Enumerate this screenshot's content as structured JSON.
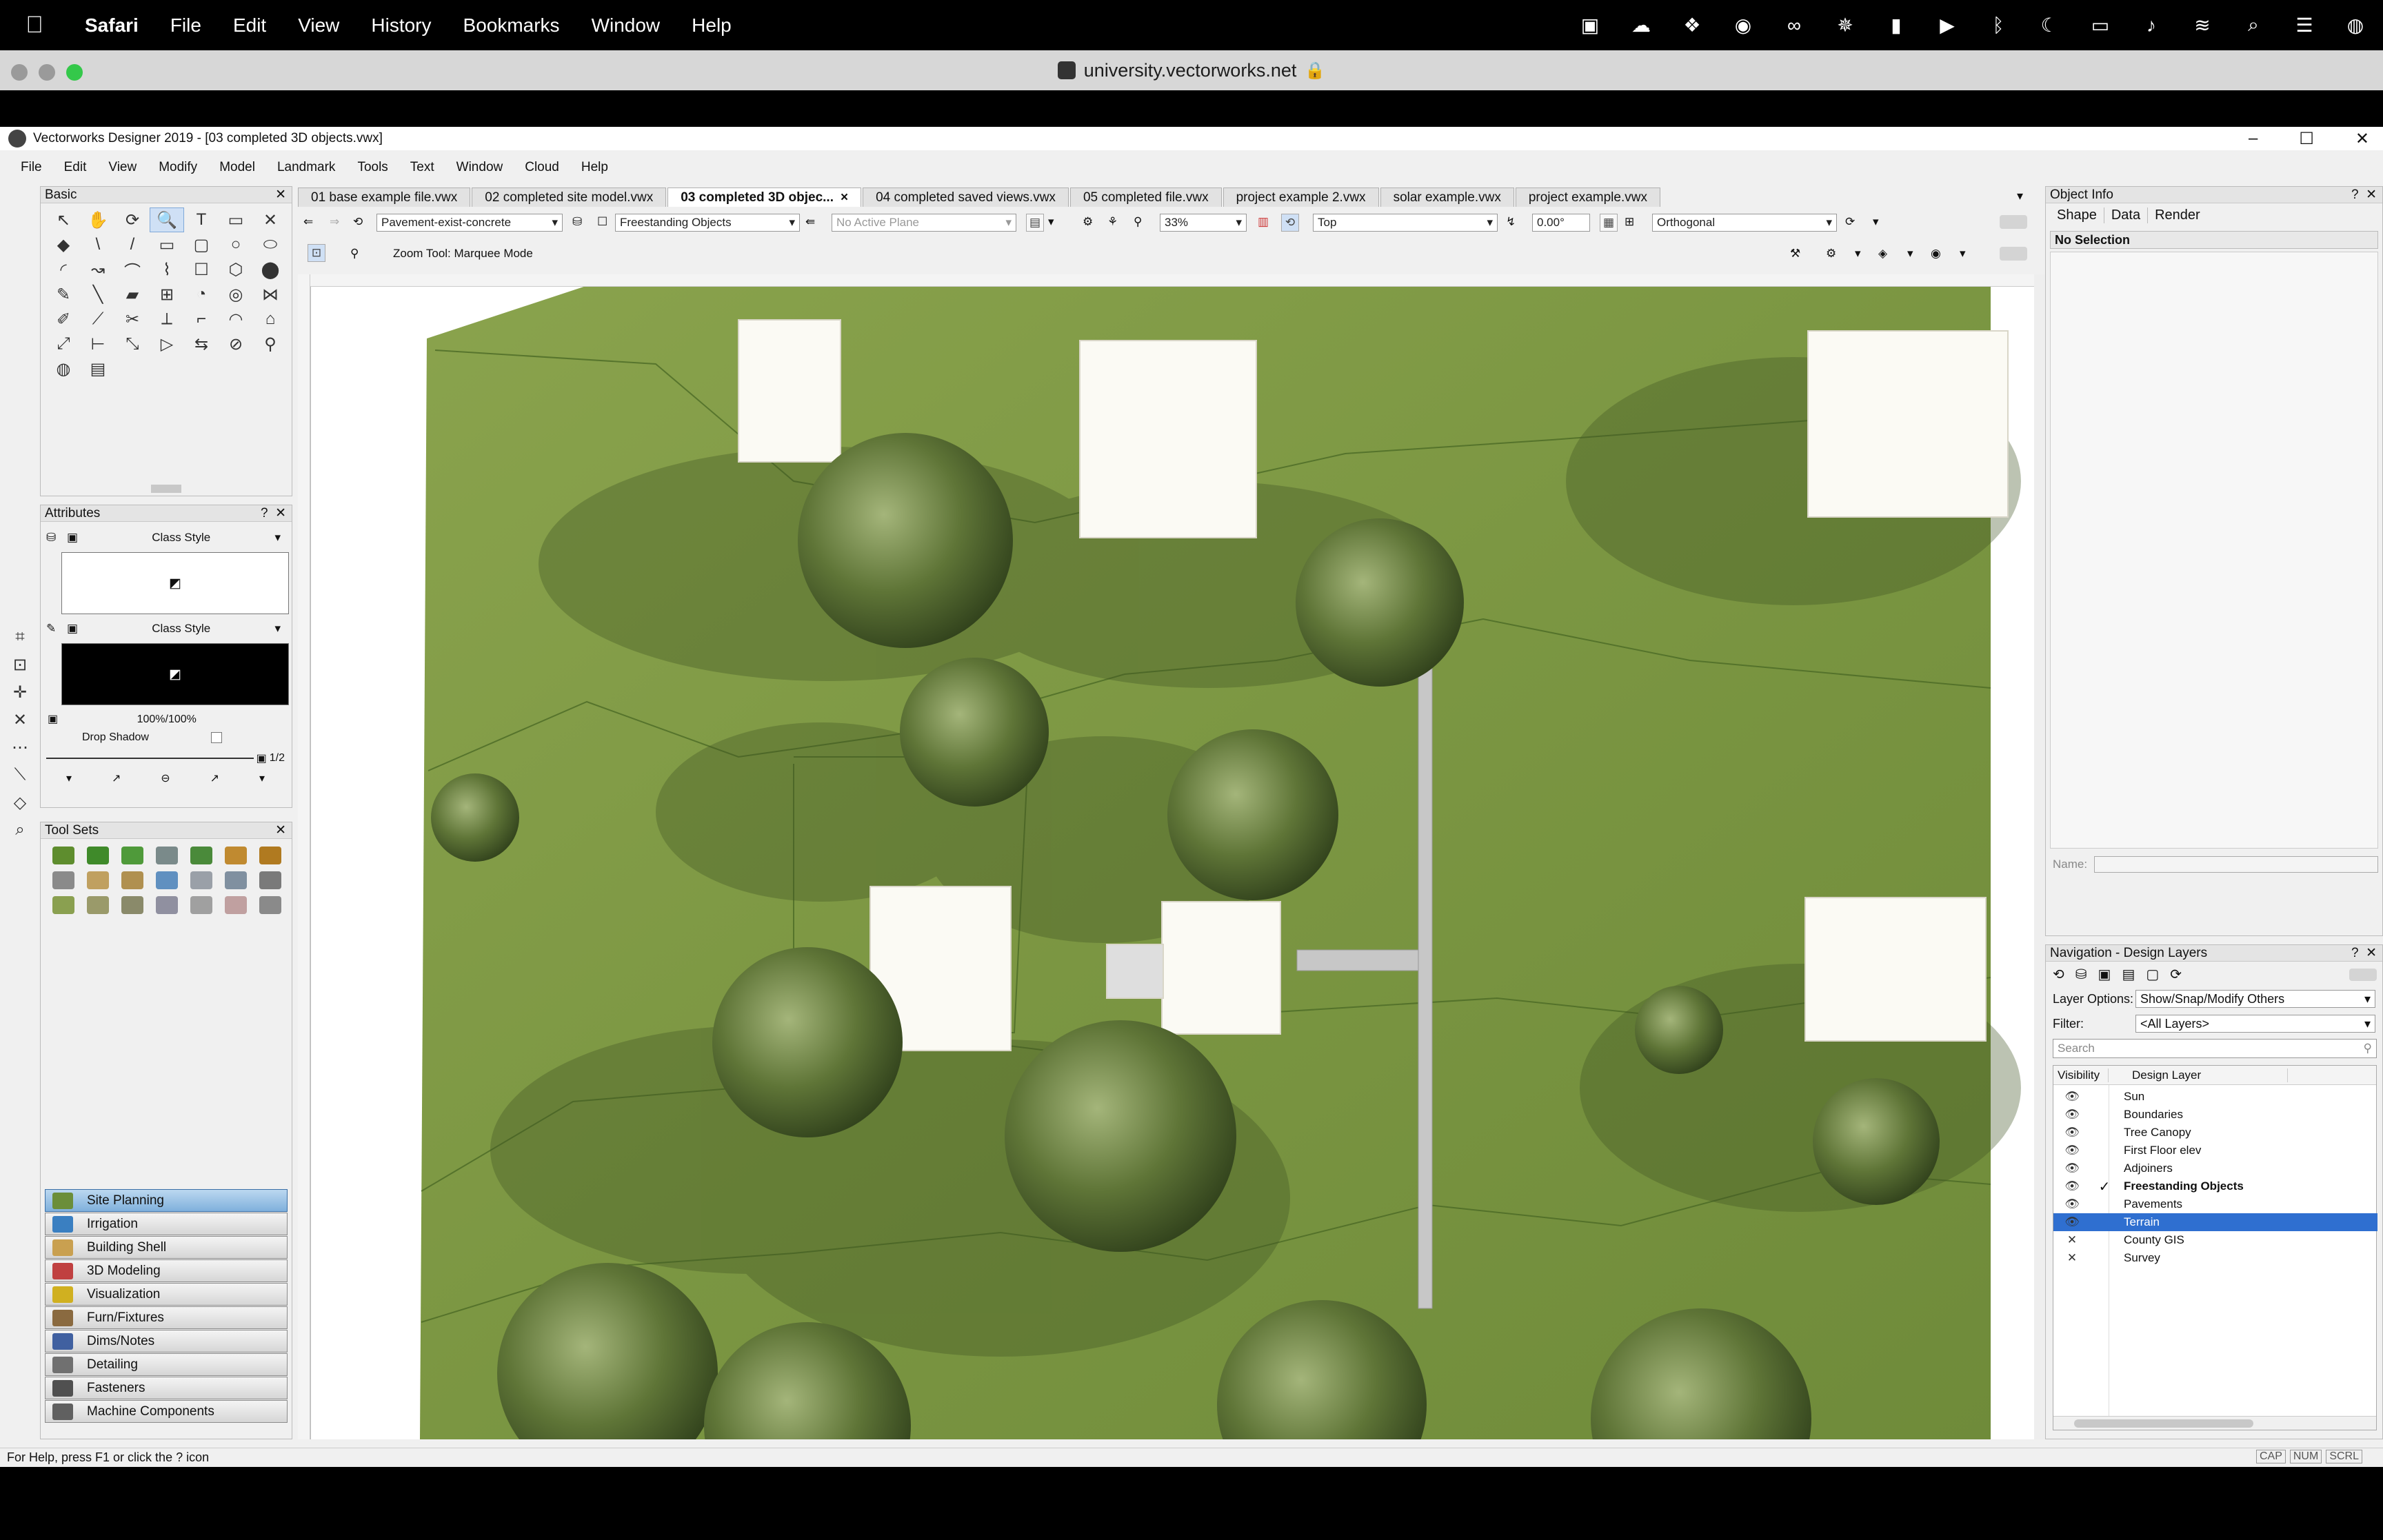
{
  "macos": {
    "app_name": "Safari",
    "menus": [
      "File",
      "Edit",
      "View",
      "History",
      "Bookmarks",
      "Window",
      "Help"
    ]
  },
  "safari": {
    "url": "university.vectorworks.net"
  },
  "vw": {
    "title": "Vectorworks Designer 2019 - [03 completed 3D objects.vwx]",
    "menus": [
      "File",
      "Edit",
      "View",
      "Modify",
      "Model",
      "Landmark",
      "Tools",
      "Text",
      "Window",
      "Cloud",
      "Help"
    ],
    "tabs": [
      {
        "label": "01 base example file.vwx"
      },
      {
        "label": "02 completed site model.vwx"
      },
      {
        "label": "03 completed 3D objec...",
        "active": true
      },
      {
        "label": "04 completed saved views.vwx"
      },
      {
        "label": "05 completed file.vwx"
      },
      {
        "label": "project example 2.vwx"
      },
      {
        "label": "solar example.vwx"
      },
      {
        "label": "project example.vwx"
      }
    ],
    "tab_close": "×",
    "toolbar": {
      "class": "Pavement-exist-concrete",
      "layer": "Freestanding Objects",
      "plane": "No Active Plane",
      "zoom": "33%",
      "view": "Top",
      "angle": "0.00°",
      "render": "Orthogonal"
    },
    "mode_bar": {
      "tool_hint": "Zoom Tool: Marquee Mode"
    },
    "basic_palette": {
      "title": "Basic",
      "tools": [
        "↖",
        "✋",
        "⟳",
        "🔍",
        "T",
        "▭",
        "✕",
        "◆",
        "\\",
        "/",
        "▭",
        "▢",
        "○",
        "⬭",
        "◜",
        "↝",
        "⌒",
        "⌇",
        "☐",
        "⬡",
        "⬤",
        "✎",
        "╲",
        "▰",
        "⊞",
        "◔",
        "◎",
        "⋈",
        "✐",
        "⟋",
        "✂",
        "⟂",
        "⌐",
        "◠",
        "⌂",
        "⤢",
        "⊢",
        "⤡",
        "▷",
        "⇆",
        "⊘",
        "⚲",
        "◍",
        "▤"
      ]
    },
    "attributes": {
      "title": "Attributes",
      "fill_style": "Class Style",
      "pen_style": "Class Style",
      "opacity": "100%/100%",
      "drop_shadow": "Drop Shadow",
      "page": "1/2"
    },
    "tool_sets": {
      "title": "Tool Sets",
      "workspaces": [
        {
          "label": "Site Planning",
          "color": "#6b8e3a",
          "active": true
        },
        {
          "label": "Irrigation",
          "color": "#3a7fc1"
        },
        {
          "label": "Building Shell",
          "color": "#c9a050"
        },
        {
          "label": "3D Modeling",
          "color": "#c04040"
        },
        {
          "label": "Visualization",
          "color": "#d0b020"
        },
        {
          "label": "Furn/Fixtures",
          "color": "#8a6a40"
        },
        {
          "label": "Dims/Notes",
          "color": "#4060a0"
        },
        {
          "label": "Detailing",
          "color": "#707070"
        },
        {
          "label": "Fasteners",
          "color": "#505050"
        },
        {
          "label": "Machine Components",
          "color": "#606060"
        }
      ]
    },
    "object_info": {
      "title": "Object Info",
      "tabs": [
        "Shape",
        "Data",
        "Render"
      ],
      "selection": "No Selection",
      "name_label": "Name:"
    },
    "navigation": {
      "title": "Navigation - Design Layers",
      "layer_options_label": "Layer Options:",
      "layer_options_value": "Show/Snap/Modify Others",
      "filter_label": "Filter:",
      "filter_value": "<All Layers>",
      "search_placeholder": "Search",
      "col_visibility": "Visibility",
      "col_layer": "Design Layer",
      "layers": [
        {
          "name": "Sun",
          "vis": "👁",
          "active": false
        },
        {
          "name": "Boundaries",
          "vis": "👁",
          "active": false
        },
        {
          "name": "Tree Canopy",
          "vis": "👁",
          "active": false
        },
        {
          "name": "First Floor elev",
          "vis": "👁",
          "active": false
        },
        {
          "name": "Adjoiners",
          "vis": "👁",
          "active": false
        },
        {
          "name": "Freestanding Objects",
          "vis": "👁",
          "active": true,
          "check": "✓"
        },
        {
          "name": "Pavements",
          "vis": "👁",
          "active": false
        },
        {
          "name": "Terrain",
          "vis": "👁",
          "active": false,
          "selected": true
        },
        {
          "name": "County GIS",
          "vis": "✕",
          "active": false
        },
        {
          "name": "Survey",
          "vis": "✕",
          "active": false
        }
      ]
    },
    "status": {
      "help": "For Help, press F1 or click the ? icon",
      "caps": "CAP",
      "num": "NUM",
      "scrl": "SCRL"
    }
  },
  "colors": {
    "grass": "#7f9a45",
    "selection": "#2f6fd0",
    "workspace_active": "#7fb0dc"
  },
  "drawing": {
    "houses": 6,
    "trees": 16
  }
}
